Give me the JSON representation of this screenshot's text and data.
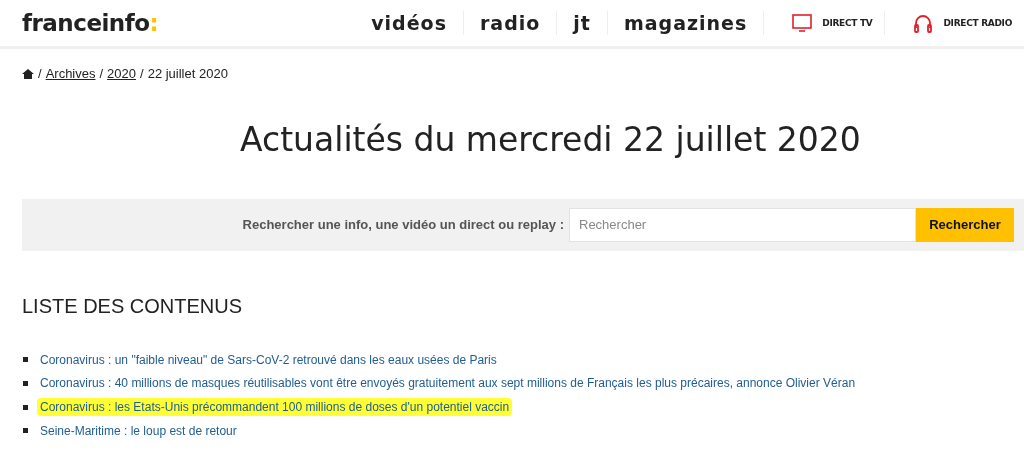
{
  "header": {
    "logo": {
      "name": "franceinfo",
      "mark": ":"
    },
    "nav": [
      "vidéos",
      "radio",
      "jt",
      "magazines"
    ],
    "live": [
      {
        "kind": "tv",
        "label": "DIRECT TV"
      },
      {
        "kind": "radio",
        "label": "DIRECT RADIO"
      }
    ]
  },
  "breadcrumb": {
    "separator": "/",
    "links": [
      "Archives",
      "2020"
    ],
    "current": "22 juillet 2020"
  },
  "title": "Actualités du mercredi 22 juillet 2020",
  "search": {
    "label": "Rechercher une info, une vidéo un direct ou replay :",
    "placeholder": "Rechercher",
    "button": "Rechercher"
  },
  "list": {
    "heading": "LISTE DES CONTENUS",
    "items": [
      {
        "text": "Coronavirus : un \"faible niveau\" de Sars-CoV-2 retrouvé dans les eaux usées de Paris",
        "highlighted": false
      },
      {
        "text": "Coronavirus : 40 millions de masques réutilisables vont être envoyés gratuitement aux sept millions de Français les plus précaires, annonce Olivier Véran",
        "highlighted": false
      },
      {
        "text": "Coronavirus : les Etats-Unis précommandent 100 millions de doses d'un potentiel vaccin",
        "highlighted": true
      },
      {
        "text": "Seine-Maritime : le loup est de retour",
        "highlighted": false
      }
    ]
  }
}
